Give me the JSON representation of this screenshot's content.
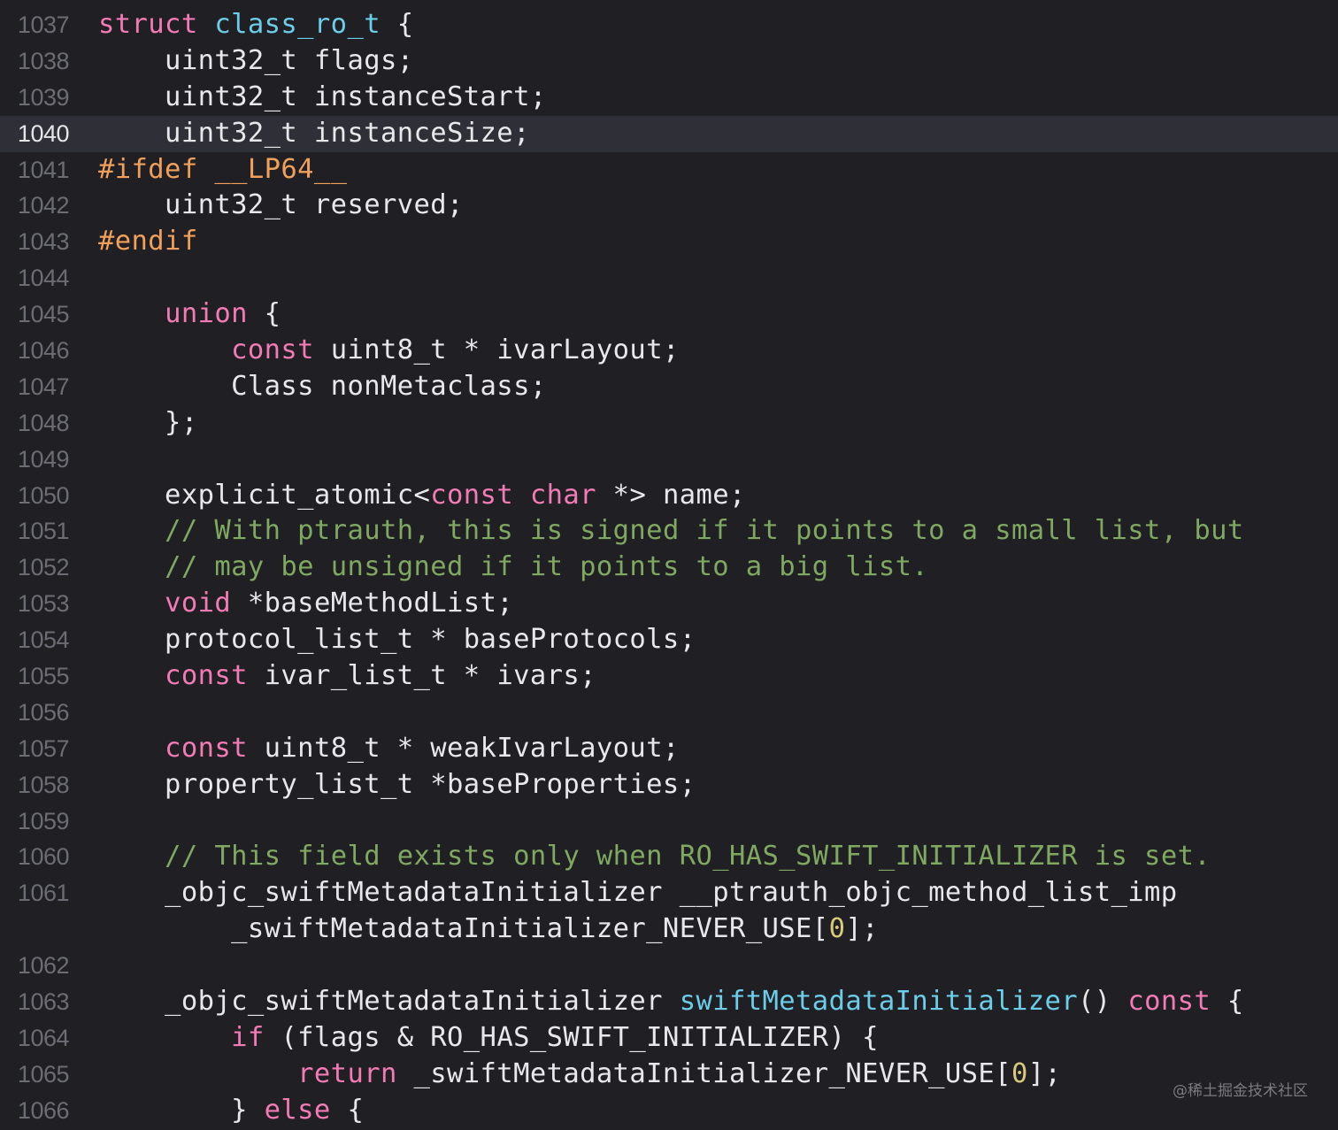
{
  "editor": {
    "current_line": "1040",
    "lines": [
      {
        "no": "1037",
        "tokens": [
          [
            "kw",
            "struct"
          ],
          [
            "plain",
            " "
          ],
          [
            "type",
            "class_ro_t"
          ],
          [
            "plain",
            " {"
          ]
        ]
      },
      {
        "no": "1038",
        "tokens": [
          [
            "plain",
            "    uint32_t flags;"
          ]
        ]
      },
      {
        "no": "1039",
        "tokens": [
          [
            "plain",
            "    uint32_t instanceStart;"
          ]
        ]
      },
      {
        "no": "1040",
        "tokens": [
          [
            "plain",
            "    uint32_t instanceSize;"
          ]
        ]
      },
      {
        "no": "1041",
        "tokens": [
          [
            "pp",
            "#ifdef __LP64__"
          ]
        ]
      },
      {
        "no": "1042",
        "tokens": [
          [
            "plain",
            "    uint32_t reserved;"
          ]
        ]
      },
      {
        "no": "1043",
        "tokens": [
          [
            "pp",
            "#endif"
          ]
        ]
      },
      {
        "no": "1044",
        "tokens": []
      },
      {
        "no": "1045",
        "tokens": [
          [
            "plain",
            "    "
          ],
          [
            "kw",
            "union"
          ],
          [
            "plain",
            " {"
          ]
        ]
      },
      {
        "no": "1046",
        "tokens": [
          [
            "plain",
            "        "
          ],
          [
            "kw",
            "const"
          ],
          [
            "plain",
            " uint8_t * ivarLayout;"
          ]
        ]
      },
      {
        "no": "1047",
        "tokens": [
          [
            "plain",
            "        Class nonMetaclass;"
          ]
        ]
      },
      {
        "no": "1048",
        "tokens": [
          [
            "plain",
            "    };"
          ]
        ]
      },
      {
        "no": "1049",
        "tokens": []
      },
      {
        "no": "1050",
        "tokens": [
          [
            "plain",
            "    explicit_atomic<"
          ],
          [
            "kw",
            "const"
          ],
          [
            "plain",
            " "
          ],
          [
            "kw",
            "char"
          ],
          [
            "plain",
            " *> name;"
          ]
        ]
      },
      {
        "no": "1051",
        "tokens": [
          [
            "plain",
            "    "
          ],
          [
            "cm",
            "// With ptrauth, this is signed if it points to a small list, but"
          ]
        ]
      },
      {
        "no": "1052",
        "tokens": [
          [
            "plain",
            "    "
          ],
          [
            "cm",
            "// may be unsigned if it points to a big list."
          ]
        ]
      },
      {
        "no": "1053",
        "tokens": [
          [
            "plain",
            "    "
          ],
          [
            "kw",
            "void"
          ],
          [
            "plain",
            " *baseMethodList;"
          ]
        ]
      },
      {
        "no": "1054",
        "tokens": [
          [
            "plain",
            "    protocol_list_t * baseProtocols;"
          ]
        ]
      },
      {
        "no": "1055",
        "tokens": [
          [
            "plain",
            "    "
          ],
          [
            "kw",
            "const"
          ],
          [
            "plain",
            " ivar_list_t * ivars;"
          ]
        ]
      },
      {
        "no": "1056",
        "tokens": []
      },
      {
        "no": "1057",
        "tokens": [
          [
            "plain",
            "    "
          ],
          [
            "kw",
            "const"
          ],
          [
            "plain",
            " uint8_t * weakIvarLayout;"
          ]
        ]
      },
      {
        "no": "1058",
        "tokens": [
          [
            "plain",
            "    property_list_t *baseProperties;"
          ]
        ]
      },
      {
        "no": "1059",
        "tokens": []
      },
      {
        "no": "1060",
        "tokens": [
          [
            "plain",
            "    "
          ],
          [
            "cm",
            "// This field exists only when RO_HAS_SWIFT_INITIALIZER is set."
          ]
        ]
      },
      {
        "no": "1061",
        "wrap": true,
        "tokens": [
          [
            "plain",
            "    _objc_swiftMetadataInitializer __ptrauth_objc_method_list_imp\n        _swiftMetadataInitializer_NEVER_USE["
          ],
          [
            "num",
            "0"
          ],
          [
            "plain",
            "];"
          ]
        ]
      },
      {
        "no": "1062",
        "tokens": []
      },
      {
        "no": "1063",
        "tokens": [
          [
            "plain",
            "    _objc_swiftMetadataInitializer "
          ],
          [
            "fn",
            "swiftMetadataInitializer"
          ],
          [
            "plain",
            "() "
          ],
          [
            "kw",
            "const"
          ],
          [
            "plain",
            " {"
          ]
        ]
      },
      {
        "no": "1064",
        "tokens": [
          [
            "plain",
            "        "
          ],
          [
            "kw",
            "if"
          ],
          [
            "plain",
            " (flags & RO_HAS_SWIFT_INITIALIZER) {"
          ]
        ]
      },
      {
        "no": "1065",
        "tokens": [
          [
            "plain",
            "            "
          ],
          [
            "kw",
            "return"
          ],
          [
            "plain",
            " _swiftMetadataInitializer_NEVER_USE["
          ],
          [
            "num",
            "0"
          ],
          [
            "plain",
            "];"
          ]
        ]
      },
      {
        "no": "1066",
        "tokens": [
          [
            "plain",
            "        } "
          ],
          [
            "kw",
            "else"
          ],
          [
            "plain",
            " {"
          ]
        ]
      }
    ]
  },
  "watermark": {
    "text": "@稀土掘金技术社区"
  },
  "colors": {
    "background": "#1f1f24",
    "current_line_bg": "#2f3037",
    "keyword": "#f37bb4",
    "preprocessor": "#f0a05a",
    "type_decl": "#6bcde8",
    "comment": "#7fa860",
    "number": "#d9c97c",
    "plain": "#e8e8ea",
    "line_number": "#6c6c74"
  }
}
